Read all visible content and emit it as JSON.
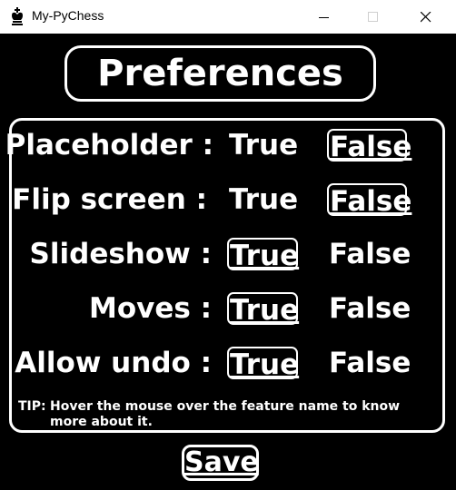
{
  "window": {
    "title": "My-PyChess",
    "icon": "chess-king-icon",
    "controls": [
      "minimize-icon",
      "maximize-icon",
      "close-icon"
    ]
  },
  "page": {
    "title": "Preferences"
  },
  "options_labels": {
    "true": "True",
    "false": "False"
  },
  "preferences": [
    {
      "label": "Placeholder :",
      "value": false
    },
    {
      "label": "Flip screen :",
      "value": false
    },
    {
      "label": "Slideshow :",
      "value": true
    },
    {
      "label": "Moves :",
      "value": true
    },
    {
      "label": "Allow undo :",
      "value": true
    }
  ],
  "tip": {
    "prefix": "TIP:",
    "text": "Hover the mouse over the feature name to know more about it."
  },
  "save_label": "Save",
  "colors": {
    "background": "#000000",
    "foreground": "#ffffff",
    "titlebar": "#ffffff"
  }
}
